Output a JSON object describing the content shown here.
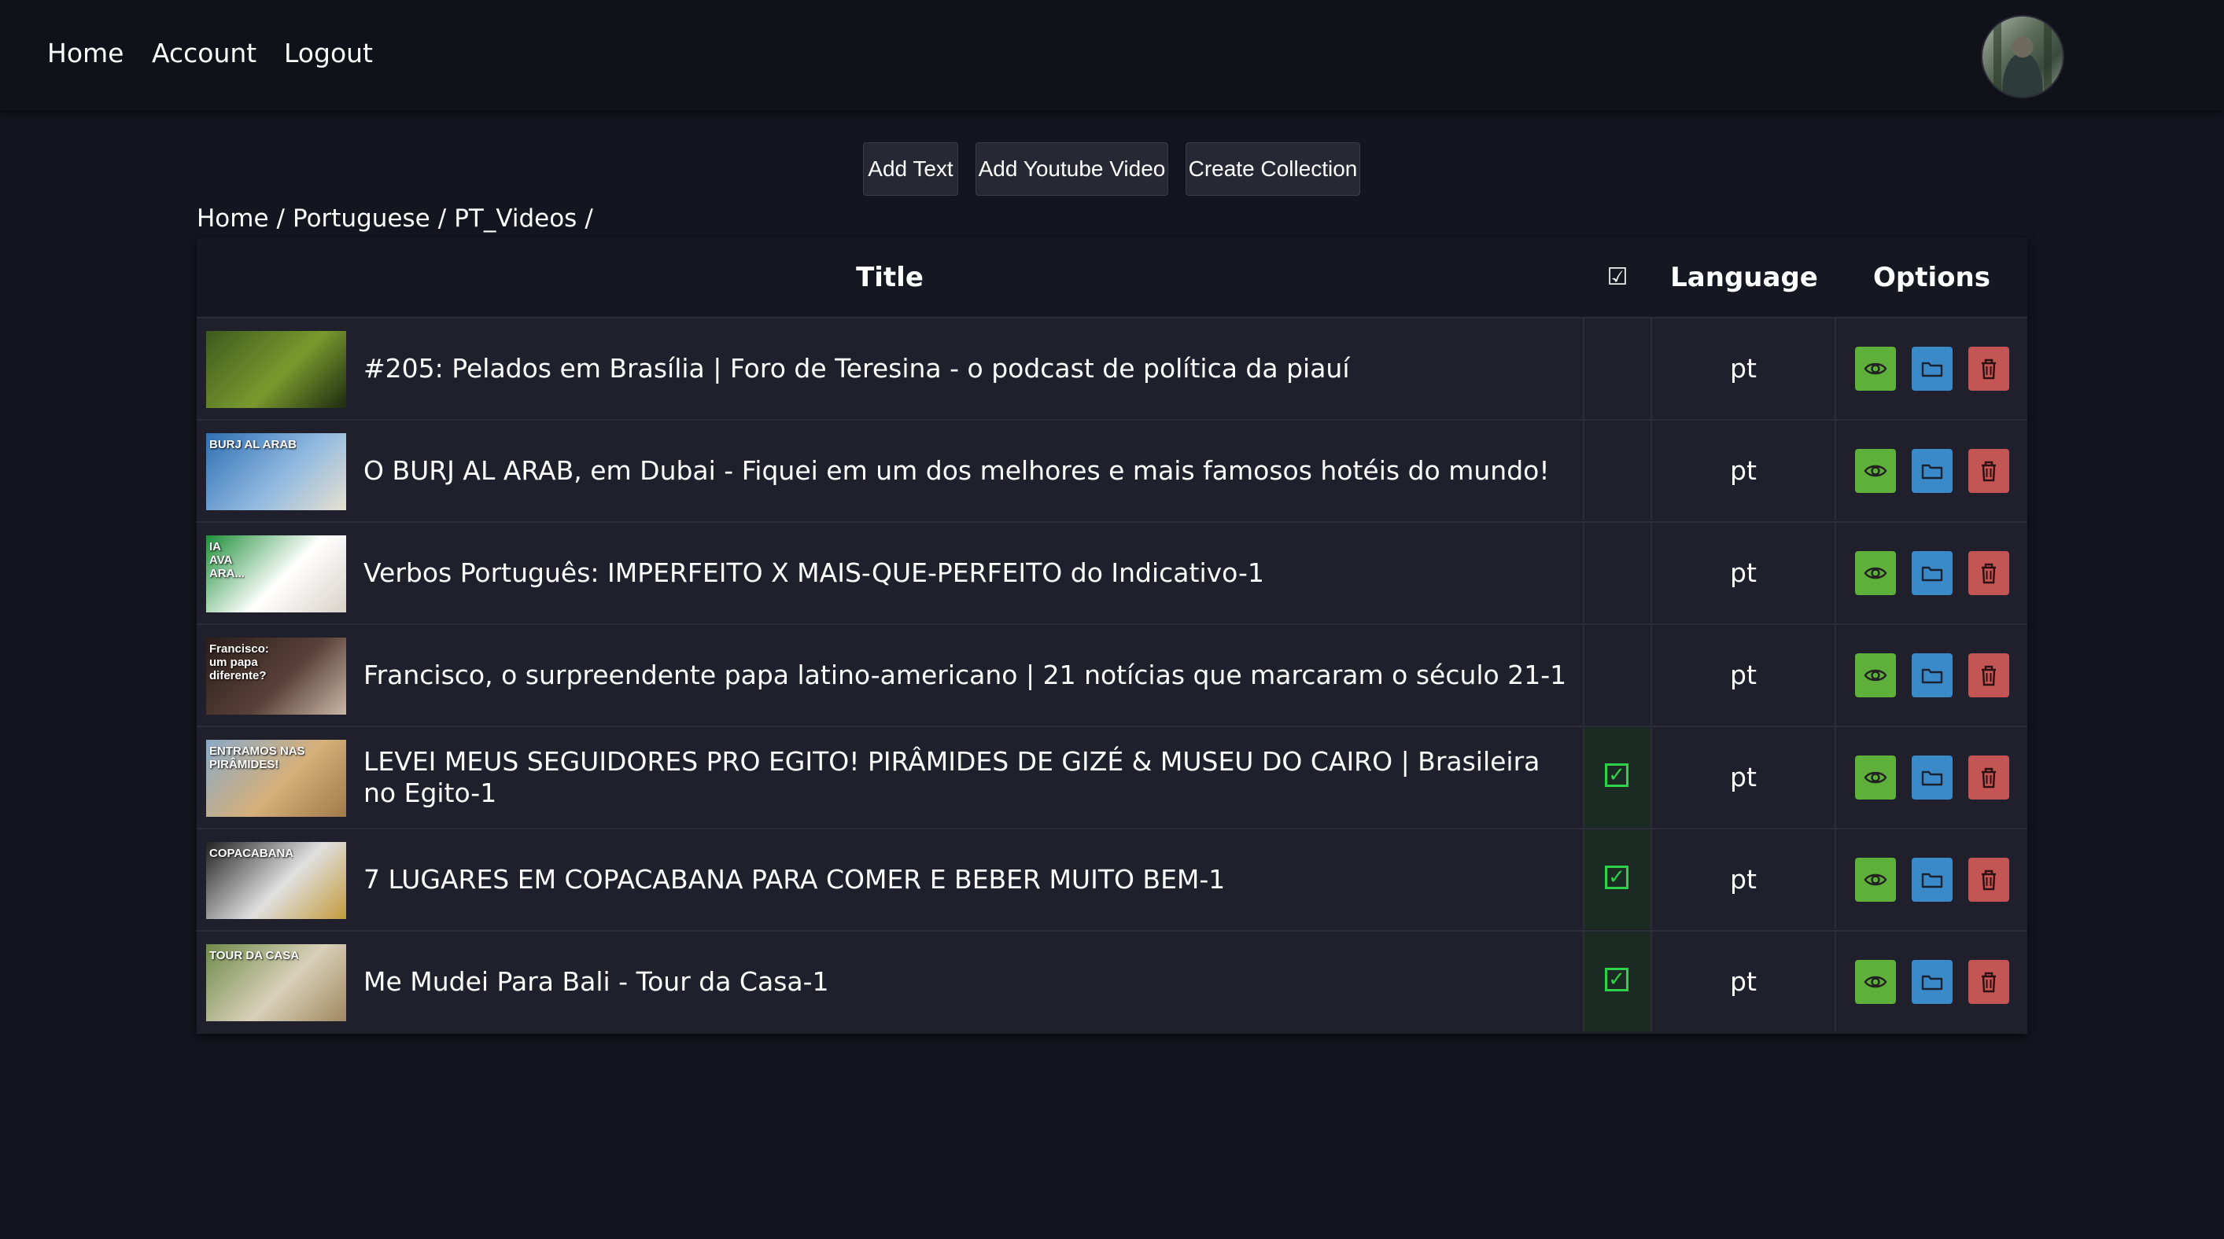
{
  "nav": {
    "home": "Home",
    "account": "Account",
    "logout": "Logout"
  },
  "actions": {
    "add_text": "Add Text",
    "add_youtube": "Add Youtube Video",
    "create_collection": "Create Collection"
  },
  "breadcrumb": [
    "Home",
    "Portuguese",
    "PT_Videos"
  ],
  "table": {
    "headers": {
      "title": "Title",
      "check": "☑",
      "language": "Language",
      "options": "Options"
    },
    "rows": [
      {
        "title": "#205: Pelados em Brasília | Foro de Teresina - o podcast de política da piauí",
        "checked": false,
        "language": "pt",
        "thumb_text": "",
        "thumb_colors": [
          "#3d5a1e",
          "#7a9a2e",
          "#1d2a10"
        ]
      },
      {
        "title": "O BURJ AL ARAB, em Dubai - Fiquei em um dos melhores e mais famosos hotéis do mundo!",
        "checked": false,
        "language": "pt",
        "thumb_text": "BURJ AL ARAB",
        "thumb_colors": [
          "#2f6fb3",
          "#8fb9e0",
          "#e8e0d0"
        ]
      },
      {
        "title": "Verbos Português: IMPERFEITO X MAIS-QUE-PERFEITO do Indicativo-1",
        "checked": false,
        "language": "pt",
        "thumb_text": "IA\nAVA\nARA...",
        "thumb_colors": [
          "#1f8f3a",
          "#ffffff",
          "#d8d2c8"
        ]
      },
      {
        "title": "Francisco, o surpreendente papa latino-americano | 21 notícias que marcaram o século 21-1",
        "checked": false,
        "language": "pt",
        "thumb_text": "Francisco:\num papa\ndiferente?",
        "thumb_colors": [
          "#2a1e1c",
          "#5a4038",
          "#c9b7a6"
        ]
      },
      {
        "title": "LEVEI MEUS SEGUIDORES PRO EGITO! PIRÂMIDES DE GIZÉ & MUSEU DO CAIRO | Brasileira no Egito-1",
        "checked": true,
        "language": "pt",
        "thumb_text": "ENTRAMOS NAS\nPIRÂMIDES!",
        "thumb_colors": [
          "#8aa9c7",
          "#d6b07a",
          "#a07a48"
        ]
      },
      {
        "title": "7 LUGARES EM COPACABANA PARA COMER E BEBER MUITO BEM-1",
        "checked": true,
        "language": "pt",
        "thumb_text": "COPACABANA",
        "thumb_colors": [
          "#222222",
          "#e0e0e0",
          "#c29a3a"
        ]
      },
      {
        "title": "Me Mudei Para Bali - Tour da Casa-1",
        "checked": true,
        "language": "pt",
        "thumb_text": "TOUR DA CASA",
        "thumb_colors": [
          "#6f8a4a",
          "#d8d0b8",
          "#a08860"
        ]
      }
    ]
  },
  "colors": {
    "background": "#14151f",
    "navbar": "#101119",
    "table": "#1f202b",
    "view": "#5fb03a",
    "folder": "#3a89c9",
    "delete": "#c45555",
    "check": "#2fd14a"
  }
}
